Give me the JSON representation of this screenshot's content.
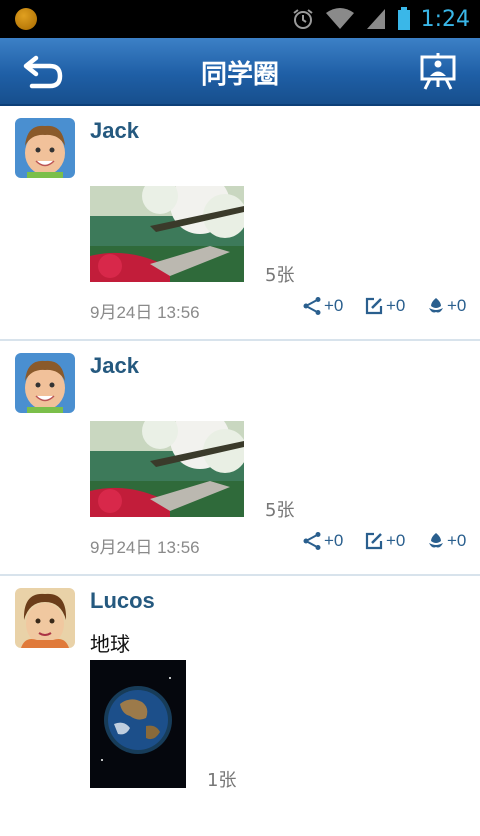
{
  "status_bar": {
    "time": "1:24"
  },
  "header": {
    "title": "同学圈"
  },
  "posts": [
    {
      "username": "Jack",
      "text": "",
      "photo_count": "5张",
      "timestamp": "9月24日 13:56",
      "share_count": "+0",
      "comment_count": "+0",
      "like_count": "+0"
    },
    {
      "username": "Jack",
      "text": "",
      "photo_count": "5张",
      "timestamp": "9月24日 13:56",
      "share_count": "+0",
      "comment_count": "+0",
      "like_count": "+0"
    },
    {
      "username": "Lucos",
      "text": "地球",
      "photo_count": "1张",
      "timestamp": "",
      "share_count": "",
      "comment_count": "",
      "like_count": ""
    }
  ],
  "colors": {
    "accent": "#1f5fa6",
    "username": "#25597f",
    "action": "#2a5f8e"
  }
}
